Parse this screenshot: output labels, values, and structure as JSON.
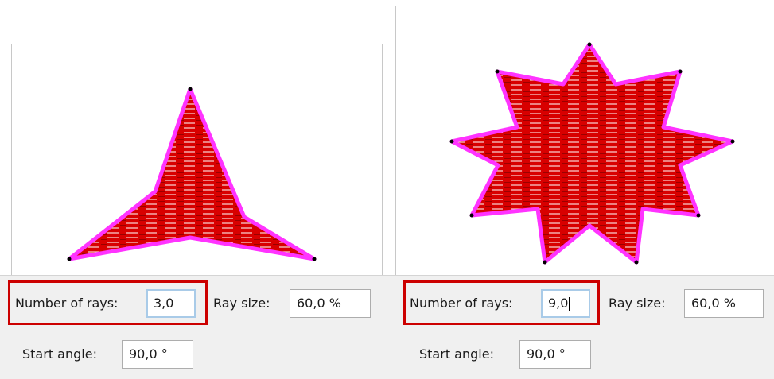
{
  "colors": {
    "fill": "#e60000",
    "outline": "#ff33ff",
    "stitch": "#ffffff",
    "highlight": "#cc0000"
  },
  "panels": [
    {
      "rays_label": "Number of rays:",
      "rays_value": "3,0",
      "ray_size_label": "Ray size:",
      "ray_size_value": "60,0 %",
      "start_angle_label": "Start angle:",
      "start_angle_value": "90,0 °"
    },
    {
      "rays_label": "Number of rays:",
      "rays_value": "9,0",
      "ray_size_label": "Ray size:",
      "ray_size_value": "60,0 %",
      "start_angle_label": "Start angle:",
      "start_angle_value": "90,0 °"
    }
  ]
}
